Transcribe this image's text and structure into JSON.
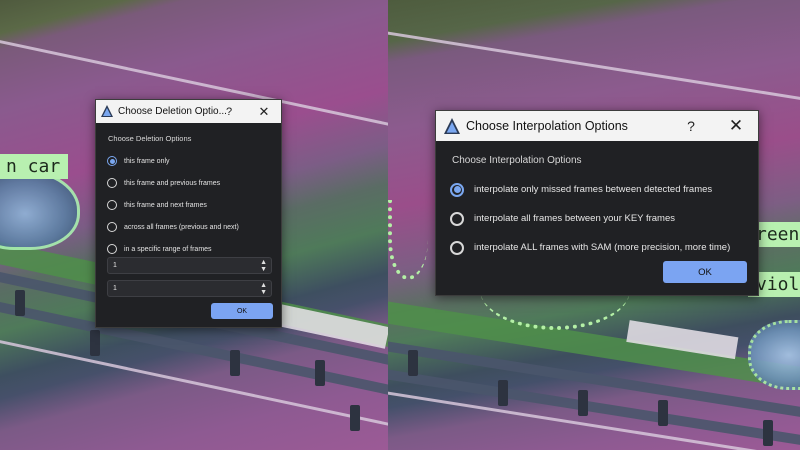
{
  "scene_left": {
    "label_text": "n car"
  },
  "scene_right": {
    "label_top": "reen",
    "label_bottom": "viole"
  },
  "deletion_dialog": {
    "title": "Choose Deletion Optio...",
    "help_label": "?",
    "close_label": "✕",
    "group_label": "Choose Deletion Options",
    "options": [
      {
        "label": "this frame only",
        "checked": true
      },
      {
        "label": "this frame and previous frames",
        "checked": false
      },
      {
        "label": "this frame and next frames",
        "checked": false
      },
      {
        "label": "across all frames (previous and next)",
        "checked": false
      },
      {
        "label": "in a specific range of frames",
        "checked": false
      }
    ],
    "range_start_value": "1",
    "range_end_value": "1",
    "ok_label": "OK"
  },
  "interpolation_dialog": {
    "title": "Choose Interpolation Options",
    "help_label": "?",
    "close_label": "✕",
    "group_label": "Choose Interpolation Options",
    "options": [
      {
        "label": "interpolate only missed frames between detected frames",
        "checked": true
      },
      {
        "label": "interpolate all frames between your KEY frames",
        "checked": false
      },
      {
        "label": "interpolate ALL frames with SAM (more precision, more time)",
        "checked": false
      }
    ],
    "ok_label": "OK"
  },
  "colors": {
    "accent": "#7aa7f0",
    "ok_button": "#7ba4f2",
    "dialog_bg": "#202124",
    "title_bar": "#f3f3f3",
    "label_tag": "#b8f0b0"
  },
  "icons": {
    "app": "app-logo-icon",
    "help": "help-icon",
    "close": "close-icon",
    "spin_up": "chevron-up-icon",
    "spin_down": "chevron-down-icon"
  }
}
